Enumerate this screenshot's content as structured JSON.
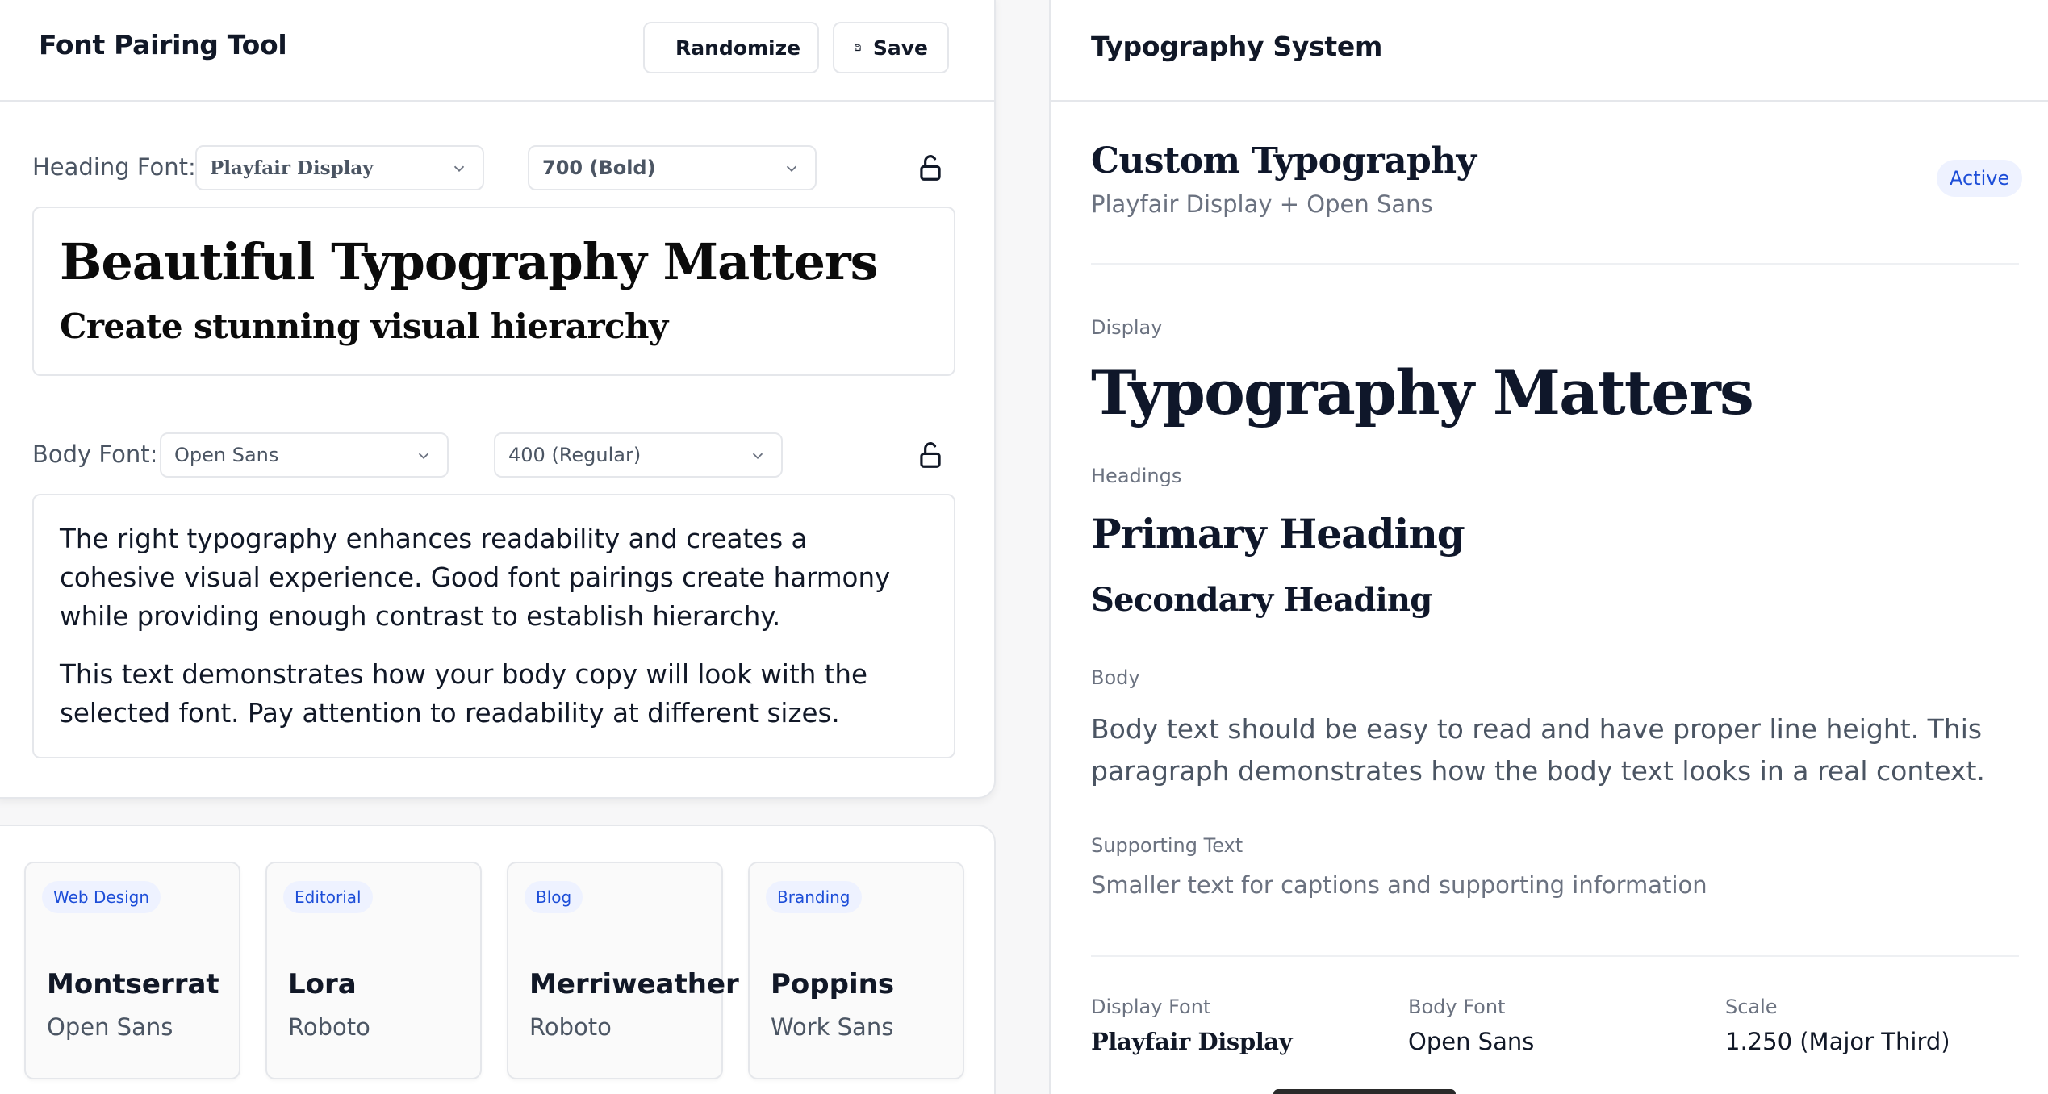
{
  "app": {
    "title": "Font Pairing Tool",
    "randomize_label": "Randomize",
    "save_label": "Save"
  },
  "heading_font": {
    "label": "Heading Font:",
    "family": "Playfair Display",
    "weight": "700 (Bold)",
    "preview_title": "Beautiful Typography Matters",
    "preview_subtitle": "Create stunning visual hierarchy"
  },
  "body_font": {
    "label": "Body Font:",
    "family": "Open Sans",
    "weight": "400 (Regular)",
    "paragraphs": [
      "The right typography enhances readability and creates a cohesive visual experience. Good font pairings create harmony while providing enough contrast to establish hierarchy.",
      "This text demonstrates how your body copy will look with the selected font. Pay attention to readability at different sizes."
    ]
  },
  "pairings": [
    {
      "tag": "Web Design",
      "heading": "Montserrat",
      "body": "Open Sans"
    },
    {
      "tag": "Editorial",
      "heading": "Lora",
      "body": "Roboto"
    },
    {
      "tag": "Blog",
      "heading": "Merriweather",
      "body": "Roboto"
    },
    {
      "tag": "Branding",
      "heading": "Poppins",
      "body": "Work Sans"
    }
  ],
  "system": {
    "title": "Typography System",
    "custom_title": "Custom Typography",
    "custom_subtitle": "Playfair Display + Open Sans",
    "status": "Active",
    "display_label": "Display",
    "display_text": "Typography Matters",
    "headings_label": "Headings",
    "primary_heading": "Primary Heading",
    "secondary_heading": "Secondary Heading",
    "body_label": "Body",
    "body_text": "Body text should be easy to read and have proper line height. This paragraph demonstrates how the body text looks in a real context.",
    "supporting_label": "Supporting Text",
    "supporting_text": "Smaller text for captions and supporting information",
    "meta": {
      "display_font_label": "Display Font",
      "display_font": "Playfair Display",
      "body_font_label": "Body Font",
      "body_font": "Open Sans",
      "scale_label": "Scale",
      "scale": "1.250 (Major Third)"
    }
  },
  "icons": {
    "randomize": "refresh-icon",
    "save": "save-icon",
    "dropdown": "chevron-down-icon",
    "lock": "unlock-icon"
  },
  "colors": {
    "accent": "#1d4ed8",
    "badge_bg": "#eef2ff",
    "border": "#e5e7eb",
    "muted_text": "#6b7280"
  }
}
